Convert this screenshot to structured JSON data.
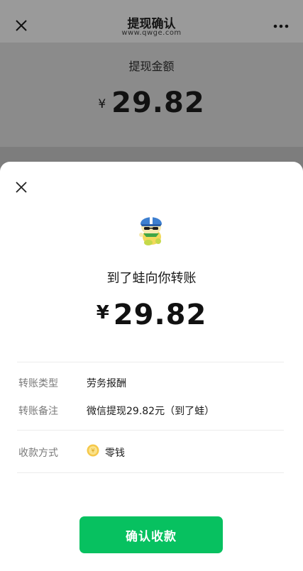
{
  "background_page": {
    "title": "提现确认",
    "subtitle": "www.qwge.com",
    "amount_label": "提现金额",
    "currency_symbol": "¥",
    "amount": "29.82",
    "close_icon": "close-icon",
    "more_icon": "more-icon"
  },
  "sheet": {
    "close_icon": "close-icon",
    "avatar_icon": "frog-avatar-icon",
    "payer_text": "到了蛙向你转账",
    "currency_symbol": "¥",
    "amount": "29.82",
    "details": [
      {
        "label": "转账类型",
        "value": "劳务报酬"
      },
      {
        "label": "转账备注",
        "value": "微信提现29.82元（到了蛙）"
      },
      {
        "label": "收款方式",
        "value": "零钱",
        "icon": "coin-icon"
      }
    ],
    "confirm_label": "确认收款"
  },
  "colors": {
    "accent_green": "#07c160",
    "overlay": "#8e8e8e"
  }
}
